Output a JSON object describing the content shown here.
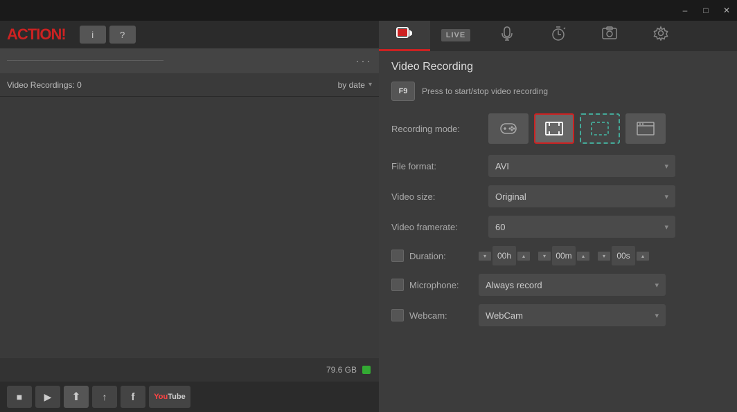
{
  "titlebar": {
    "minimize": "–",
    "maximize": "□",
    "close": "✕"
  },
  "logo": {
    "text_plain": "ACTION",
    "text_exclaim": "!",
    "info_btn": "i",
    "help_btn": "?"
  },
  "filter_bar": {
    "search_text": "────────────────────",
    "dots": "···"
  },
  "recordings": {
    "label": "Video Recordings: 0",
    "sort": "by date",
    "chevron": "▾"
  },
  "storage": {
    "text": "79.6 GB",
    "color": "#33aa33"
  },
  "bottom_toolbar": {
    "stop": "■",
    "play": "▶",
    "upload": "↑",
    "export": "↑",
    "facebook": "f",
    "youtube": "YouTube"
  },
  "tabs": [
    {
      "id": "video",
      "icon": "▣",
      "active": true
    },
    {
      "id": "live",
      "label": "LIVE",
      "active": false
    },
    {
      "id": "audio",
      "icon": "♪",
      "active": false
    },
    {
      "id": "timer",
      "icon": "⏱",
      "active": false
    },
    {
      "id": "screenshot",
      "icon": "⊡",
      "active": false
    },
    {
      "id": "settings",
      "icon": "⚙",
      "active": false
    }
  ],
  "panel": {
    "title": "Video Recording",
    "hotkey": {
      "key": "F9",
      "description": "Press to start/stop video recording"
    },
    "recording_mode_label": "Recording mode:",
    "modes": [
      {
        "id": "gamepad",
        "icon": "🎮",
        "active": false
      },
      {
        "id": "fullscreen",
        "icon": "▣",
        "active": true
      },
      {
        "id": "region",
        "icon": "⬚",
        "active": false
      },
      {
        "id": "window",
        "icon": "▭",
        "active": false
      }
    ],
    "file_format_label": "File format:",
    "file_format_value": "AVI",
    "video_size_label": "Video size:",
    "video_size_value": "Original",
    "video_framerate_label": "Video framerate:",
    "video_framerate_value": "60",
    "duration_label": "Duration:",
    "duration_hours": "00h",
    "duration_minutes": "00m",
    "duration_seconds": "00s",
    "microphone_label": "Microphone:",
    "microphone_value": "Always record",
    "webcam_label": "Webcam:",
    "webcam_value": "WebCam"
  }
}
